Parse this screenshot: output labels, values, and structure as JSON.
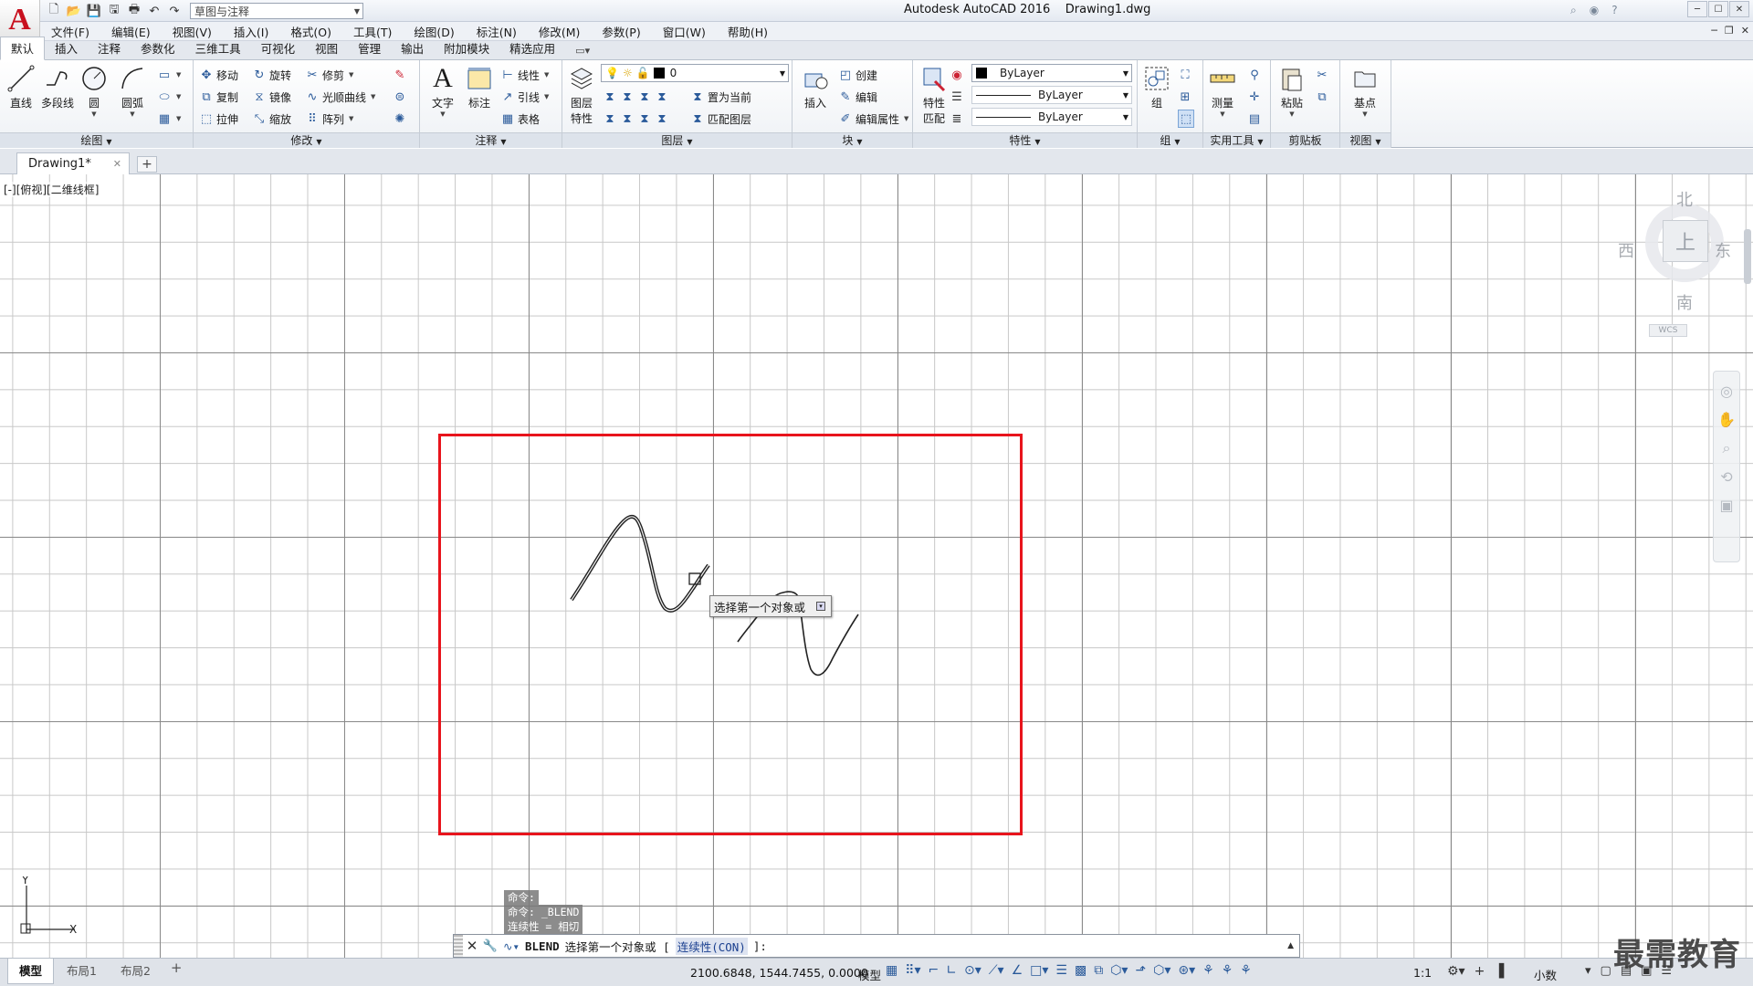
{
  "app": {
    "title": "Autodesk AutoCAD 2016    Drawing1.dwg",
    "logo": "A",
    "workspace": "草图与注释"
  },
  "menu": [
    "文件(F)",
    "编辑(E)",
    "视图(V)",
    "插入(I)",
    "格式(O)",
    "工具(T)",
    "绘图(D)",
    "标注(N)",
    "修改(M)",
    "参数(P)",
    "窗口(W)",
    "帮助(H)"
  ],
  "ribbon_tabs": [
    "默认",
    "插入",
    "注释",
    "参数化",
    "三维工具",
    "可视化",
    "视图",
    "管理",
    "输出",
    "附加模块",
    "精选应用"
  ],
  "ribbon": {
    "draw": {
      "title": "绘图",
      "line": "直线",
      "polyline": "多段线",
      "circle": "圆",
      "arc": "圆弧"
    },
    "modify": {
      "title": "修改",
      "move": "移动",
      "rotate": "旋转",
      "trim": "修剪",
      "copy": "复制",
      "mirror": "镜像",
      "spline": "光顺曲线",
      "stretch": "拉伸",
      "scale": "缩放",
      "array": "阵列"
    },
    "annotation": {
      "title": "注释",
      "text": "文字",
      "dimension": "标注",
      "linear": "线性",
      "leader": "引线",
      "table": "表格"
    },
    "layers": {
      "title": "图层",
      "properties_1": "图层",
      "properties_2": "特性",
      "current_layer": "0",
      "set_current": "置为当前",
      "match_layer": "匹配图层"
    },
    "block": {
      "title": "块",
      "insert": "插入",
      "create": "创建",
      "edit": "编辑",
      "edit_attr": "编辑属性"
    },
    "properties": {
      "title": "特性",
      "match_1": "特性",
      "match_2": "匹配",
      "color": "ByLayer",
      "linetype": "ByLayer",
      "lineweight": "ByLayer"
    },
    "groups": {
      "title": "组",
      "group": "组"
    },
    "utilities": {
      "title": "实用工具",
      "measure": "测量"
    },
    "clipboard": {
      "title": "剪贴板",
      "paste": "粘贴"
    },
    "view": {
      "title": "视图",
      "base": "基点"
    }
  },
  "file_tab": {
    "name": "Drawing1*"
  },
  "viewport": {
    "label": "[-][俯视][二维线框]",
    "viewcube": {
      "north": "北",
      "south": "南",
      "east": "东",
      "west": "西",
      "face": "上",
      "wcs": "WCS"
    }
  },
  "tooltip": "选择第一个对象或",
  "ucs": {
    "x": "X",
    "y": "Y"
  },
  "history": [
    "命令:",
    "命令: _BLEND",
    "连续性 = 相切"
  ],
  "command": {
    "cmd": "BLEND",
    "prompt": "选择第一个对象或 [",
    "option": "连续性(CON)",
    "suffix": "]:"
  },
  "status": {
    "layouts": [
      "模型",
      "布局1",
      "布局2"
    ],
    "coords": "2100.6848, 1544.7455, 0.0000",
    "model": "模型",
    "scale": "1:1",
    "units": "小数"
  },
  "watermark": "最需教育",
  "colors": {
    "selection": "#e8141c",
    "curve": "#222222",
    "grid_major": "#8a8a8a",
    "grid_minor": "#c8c8c8"
  }
}
